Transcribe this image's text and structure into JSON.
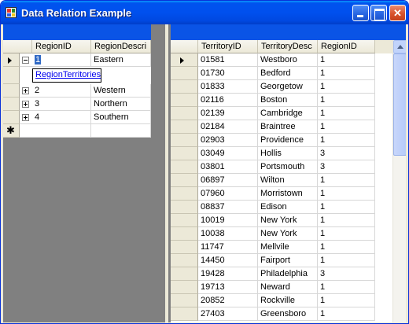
{
  "window": {
    "title": "Data Relation Example",
    "accent": "#0a54e6",
    "controls": {
      "minimize": "minimize",
      "maximize": "maximize",
      "close": "close"
    }
  },
  "regions": {
    "columns": [
      "RegionID",
      "RegionDescri"
    ],
    "rows": [
      {
        "id": "1",
        "desc": "Eastern",
        "state": "expanded"
      },
      {
        "id": "2",
        "desc": "Western",
        "state": "collapsed"
      },
      {
        "id": "3",
        "desc": "Northern",
        "state": "collapsed"
      },
      {
        "id": "4",
        "desc": "Southern",
        "state": "collapsed"
      }
    ],
    "relation_link": "RegionTerritories",
    "new_row_glyph": "✱"
  },
  "territories": {
    "columns": [
      "TerritoryID",
      "TerritoryDesc",
      "RegionID"
    ],
    "rows": [
      [
        "01581",
        "Westboro",
        "1"
      ],
      [
        "01730",
        "Bedford",
        "1"
      ],
      [
        "01833",
        "Georgetow",
        "1"
      ],
      [
        "02116",
        "Boston",
        "1"
      ],
      [
        "02139",
        "Cambridge",
        "1"
      ],
      [
        "02184",
        "Braintree",
        "1"
      ],
      [
        "02903",
        "Providence",
        "1"
      ],
      [
        "03049",
        "Hollis",
        "3"
      ],
      [
        "03801",
        "Portsmouth",
        "3"
      ],
      [
        "06897",
        "Wilton",
        "1"
      ],
      [
        "07960",
        "Morristown",
        "1"
      ],
      [
        "08837",
        "Edison",
        "1"
      ],
      [
        "10019",
        "New York",
        "1"
      ],
      [
        "10038",
        "New York",
        "1"
      ],
      [
        "11747",
        "Mellvile",
        "1"
      ],
      [
        "14450",
        "Fairport",
        "1"
      ],
      [
        "19428",
        "Philadelphia",
        "3"
      ],
      [
        "19713",
        "Neward",
        "1"
      ],
      [
        "20852",
        "Rockville",
        "1"
      ],
      [
        "27403",
        "Greensboro",
        "1"
      ]
    ]
  }
}
